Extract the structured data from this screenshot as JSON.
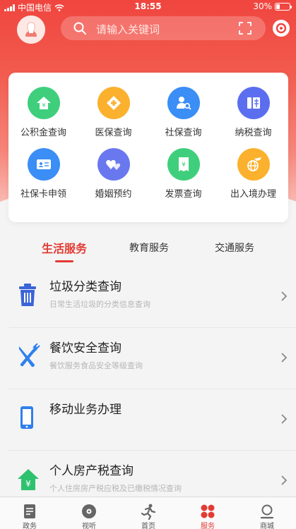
{
  "status_bar": {
    "carrier": "中国电信",
    "time": "18:55",
    "battery": "30%",
    "battery_level": 0.3
  },
  "search": {
    "placeholder": "请输入关键词"
  },
  "services_grid": [
    {
      "label": "公积金查询",
      "icon": "home-yuan-icon",
      "color": "#3fcf7c"
    },
    {
      "label": "医保查询",
      "icon": "medical-cross-icon",
      "color": "#fbb12d"
    },
    {
      "label": "社保查询",
      "icon": "person-search-icon",
      "color": "#3a8ef5"
    },
    {
      "label": "纳税查询",
      "icon": "tax-icon",
      "color": "#5b6ef0"
    },
    {
      "label": "社保卡申领",
      "icon": "id-card-icon",
      "color": "#3a8ef5"
    },
    {
      "label": "婚姻预约",
      "icon": "hearts-icon",
      "color": "#6a78ef"
    },
    {
      "label": "发票查询",
      "icon": "invoice-icon",
      "color": "#3fcf7c"
    },
    {
      "label": "出入境办理",
      "icon": "globe-plane-icon",
      "color": "#fbb12d"
    }
  ],
  "tabs": [
    {
      "label": "生活服务",
      "active": true
    },
    {
      "label": "教育服务",
      "active": false
    },
    {
      "label": "交通服务",
      "active": false
    }
  ],
  "list": [
    {
      "title": "垃圾分类查询",
      "subtitle": "日常生活垃圾的分类信息查询",
      "icon": "trash-can-icon"
    },
    {
      "title": "餐饮安全查询",
      "subtitle": "餐饮服务食品安全等级查询",
      "icon": "fork-knife-icon"
    },
    {
      "title": "移动业务办理",
      "subtitle": "",
      "icon": "mobile-phone-icon"
    },
    {
      "title": "个人房产税查询",
      "subtitle": "个人住房房产税应税及已缴税情况查询",
      "icon": "house-yuan-icon"
    }
  ],
  "tab_bar": [
    {
      "label": "政务",
      "icon": "document-icon",
      "active": false
    },
    {
      "label": "视听",
      "icon": "disc-icon",
      "active": false
    },
    {
      "label": "首页",
      "icon": "runner-icon",
      "active": false
    },
    {
      "label": "服务",
      "icon": "flower-grid-icon",
      "active": true
    },
    {
      "label": "商城",
      "icon": "shop-icon",
      "active": false
    }
  ]
}
